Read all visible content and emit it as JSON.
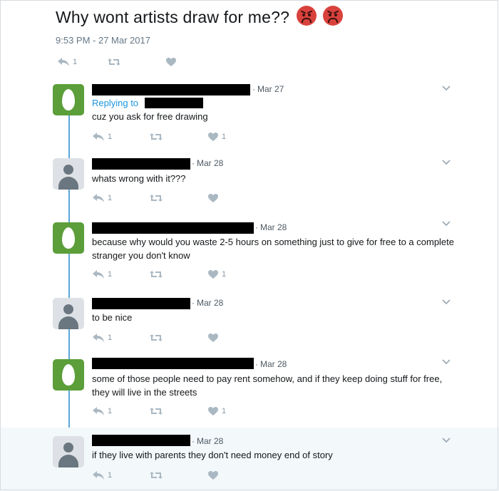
{
  "main_tweet": {
    "text": "Why wont artists draw for me??",
    "emojis": [
      "angry-face",
      "angry-face"
    ],
    "timestamp": "9:53 PM - 27 Mar 2017",
    "reply_count": "1"
  },
  "replies": [
    {
      "avatar": "green-egg",
      "date": "Mar 27",
      "replying_to": "Replying to",
      "text": "cuz you ask for free drawing",
      "reply_count": "1",
      "like_count": "1"
    },
    {
      "avatar": "gray-default",
      "date": "Mar 28",
      "text": "whats wrong with it???",
      "reply_count": "1",
      "like_count": ""
    },
    {
      "avatar": "green-egg",
      "date": "Mar 28",
      "text": "because why would you waste 2-5 hours on something just to give for free to a complete stranger you don't know",
      "reply_count": "1",
      "like_count": "1"
    },
    {
      "avatar": "gray-default",
      "date": "Mar 28",
      "text": "to be nice",
      "reply_count": "1",
      "like_count": ""
    },
    {
      "avatar": "green-egg",
      "date": "Mar 28",
      "text": "some of those people need to pay rent somehow, and if they keep doing stuff for free, they will live in the streets",
      "reply_count": "1",
      "like_count": "1"
    },
    {
      "avatar": "gray-default",
      "date": "Mar 28",
      "text": "if they live with parents they don't need money end of story",
      "reply_count": "1",
      "like_count": ""
    }
  ],
  "colors": {
    "thread_line": "#5aa9d8",
    "link": "#1b95e0",
    "egg_avatar": "#5b9e3a",
    "highlight_row": "#f3f8fb"
  }
}
